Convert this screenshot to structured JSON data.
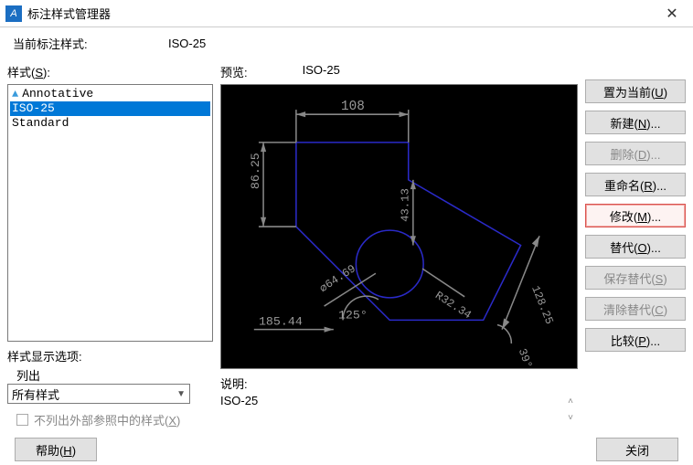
{
  "title": "标注样式管理器",
  "current_style_label": "当前标注样式:",
  "current_style_value": "ISO-25",
  "styles_label": "样式(S):",
  "styles": [
    "Annotative",
    "ISO-25",
    "Standard"
  ],
  "styles_annotative_index": 0,
  "selected_style_index": 1,
  "display_options_label": "样式显示选项:",
  "list_label": "列出",
  "dropdown_value": "所有样式",
  "checkbox_label": "不列出外部参照中的样式(X)",
  "preview_label": "预览:",
  "preview_style": "ISO-25",
  "desc_label": "说明:",
  "desc_value": "ISO-25",
  "buttons": {
    "set_current": "置为当前(U)",
    "new": "新建(N)...",
    "delete": "删除(D)...",
    "rename": "重命名(R)...",
    "modify": "修改(M)...",
    "override": "替代(O)...",
    "save_override": "保存替代(S)",
    "clear_override": "清除替代(C)",
    "compare": "比较(P)..."
  },
  "help_label": "帮助(H)",
  "close_label": "关闭",
  "chart_data": {
    "type": "diagram",
    "dimensions": {
      "top_width": "108",
      "left_height": "86.25",
      "vertical_mid": "43.13",
      "diag_right": "128.25",
      "radius": "R32.34",
      "diameter": "⌀64.69",
      "angle_left": "125°",
      "angle_right": "39°",
      "bottom": "185.44"
    }
  }
}
